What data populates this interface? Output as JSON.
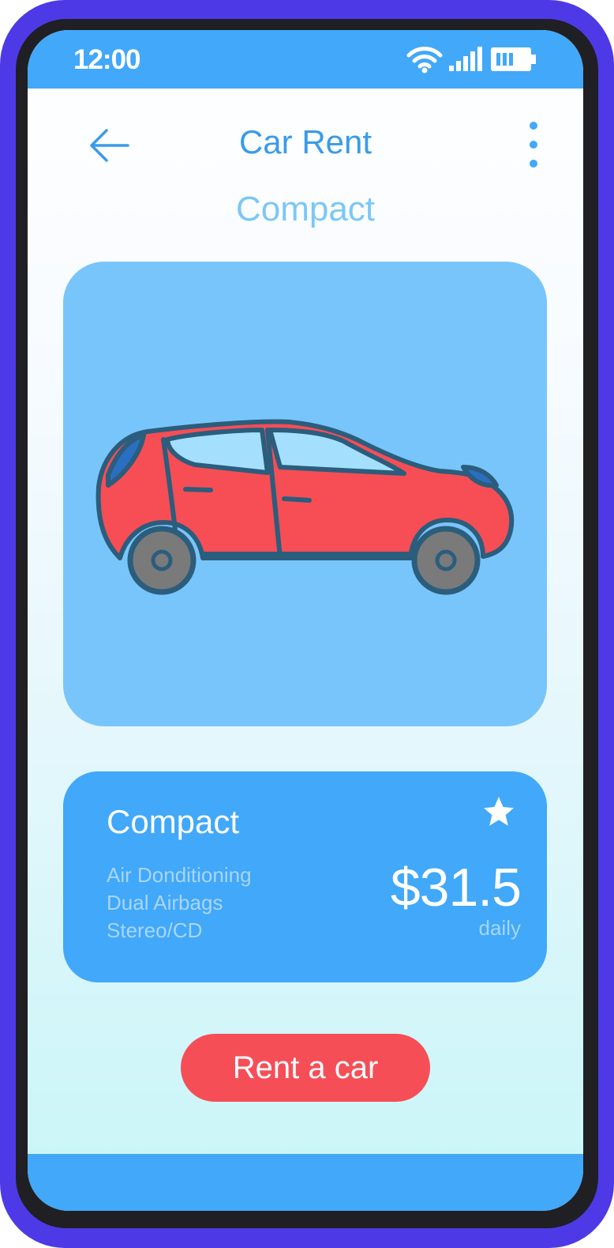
{
  "status_bar": {
    "time": "12:00",
    "wifi_icon": "wifi-icon",
    "signal_icon": "signal-bars-icon",
    "battery_icon": "battery-icon"
  },
  "header": {
    "back_icon": "arrow-left-icon",
    "title": "Car Rent",
    "menu_icon": "more-vertical-icon"
  },
  "category": "Compact",
  "car_image": {
    "icon": "red-hatchback-car-illustration"
  },
  "details": {
    "name": "Compact",
    "features": [
      "Air Donditioning",
      "Dual Airbags",
      "Stereo/CD"
    ],
    "price": "$31.5",
    "period": "daily",
    "favorite_icon": "star-icon"
  },
  "action": {
    "label": "Rent a car"
  },
  "colors": {
    "frame": "#4d3ae6",
    "bars": "#42a8f9",
    "image_card": "#78c5fb",
    "info_card": "#41a8fa",
    "button": "#f64e57",
    "title": "#3b9be8",
    "subtitle": "#7cc7f6"
  }
}
